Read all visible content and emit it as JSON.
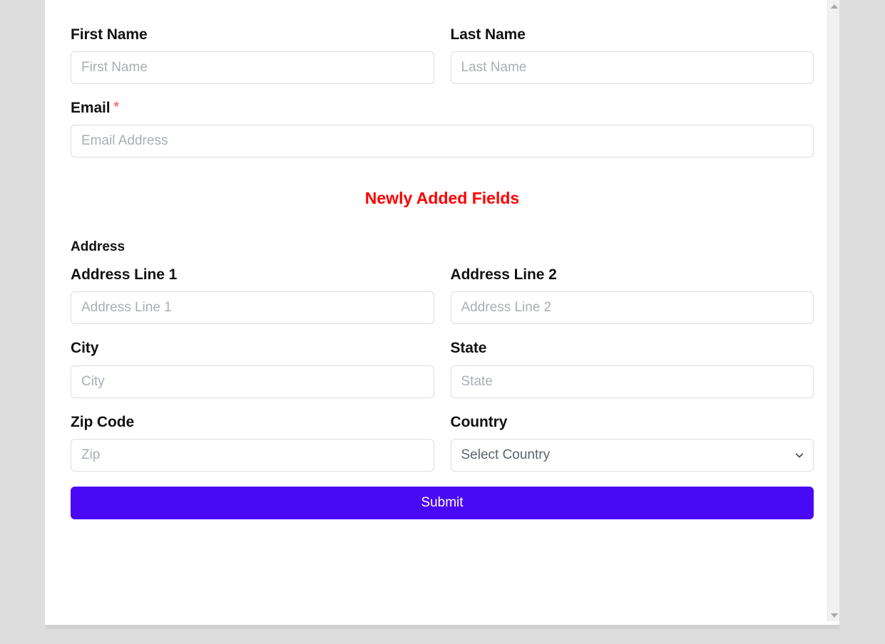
{
  "form": {
    "rows": [
      {
        "fields": [
          {
            "label": "First Name",
            "placeholder": "First Name",
            "type": "text",
            "required": false
          },
          {
            "label": "Last Name",
            "placeholder": "Last Name",
            "type": "text",
            "required": false
          }
        ]
      }
    ],
    "email": {
      "label": "Email",
      "required_marker": "*",
      "placeholder": "Email Address",
      "type": "text"
    },
    "newly_added_heading": "Newly Added Fields",
    "address_section_label": "Address",
    "address_line_1": {
      "label": "Address Line 1",
      "placeholder": "Address Line 1"
    },
    "address_line_2": {
      "label": "Address Line 2",
      "placeholder": "Address Line 2"
    },
    "city": {
      "label": "City",
      "placeholder": "City"
    },
    "state": {
      "label": "State",
      "placeholder": "State"
    },
    "zip": {
      "label": "Zip Code",
      "placeholder": "Zip"
    },
    "country": {
      "label": "Country",
      "selected": "Select Country",
      "options": [
        "Select Country"
      ],
      "chevron_icon": "chevron-down-icon"
    },
    "submit": {
      "label": "Submit"
    }
  },
  "scrollbar": {
    "up_arrow_icon": "triangle-up-icon",
    "down_arrow_icon": "triangle-down-icon"
  },
  "colors": {
    "page_background": "#dddddd",
    "card_background": "#ffffff",
    "heading_red": "#ff0000",
    "required_star": "#f97070",
    "submit_button": "#4a09f5",
    "input_border": "#d8dde3",
    "placeholder_text": "#a9afb6",
    "label_text": "#111111"
  }
}
